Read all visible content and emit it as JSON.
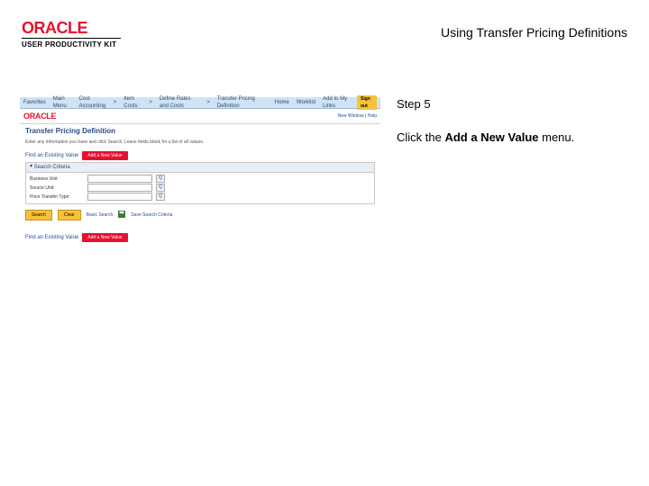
{
  "header": {
    "brand": "ORACLE",
    "product": "USER PRODUCTIVITY KIT",
    "title": "Using Transfer Pricing Definitions"
  },
  "step": {
    "label": "Step 5",
    "instruction_prefix": "Click the ",
    "instruction_bold": "Add a New Value",
    "instruction_suffix": " menu."
  },
  "app": {
    "topnav": {
      "items": [
        "Favorites",
        "Main Menu",
        "Cost Accounting",
        "Item Costs",
        "Define Rates and Costs",
        "Transfer Pricing Definition"
      ],
      "home": "Home",
      "worklist": "Worklist",
      "addfav": "Add to My Links",
      "signout": "Sign out"
    },
    "headrow": {
      "brand": "ORACLE",
      "newwin": "New Window | Help"
    },
    "page": {
      "title": "Transfer Pricing Definition",
      "desc": "Enter any information you have and click Search. Leave fields blank for a list of all values.",
      "tab_find": "Find an Existing Value",
      "tab_add": "Add a New Value",
      "box_title": "Search Criteria",
      "fields": {
        "bu": "Business Unit:",
        "su": "Source Unit:",
        "pt": "Price Transfer Type:"
      },
      "buttons": {
        "search": "Search",
        "clear": "Clear",
        "basic": "Basic Search",
        "save": "Save Search Criteria"
      },
      "footer_label": "Find an Existing Value",
      "footer_pill": "Add a New Value"
    }
  }
}
